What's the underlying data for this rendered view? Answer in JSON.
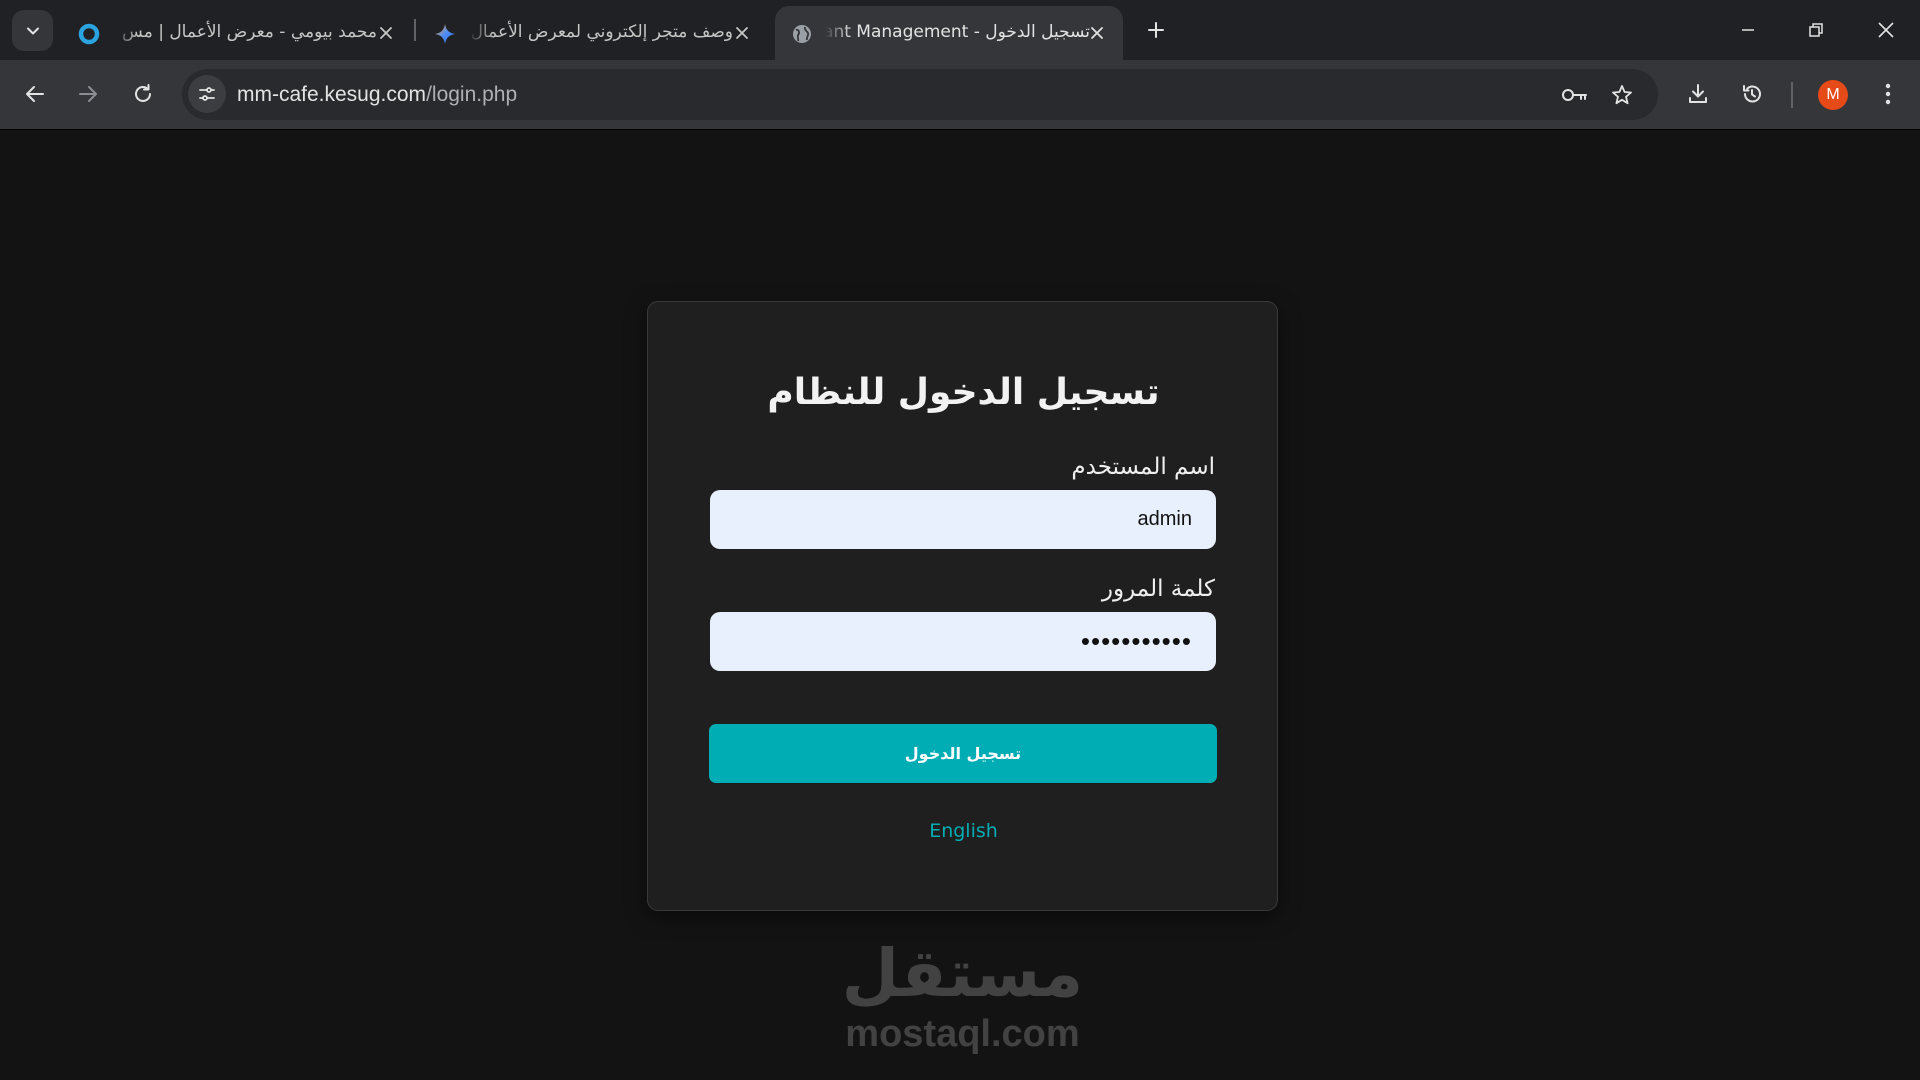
{
  "browser": {
    "tabs": [
      {
        "title": "محمد بيومي - معرض الأعمال | مس",
        "icon": "mostaql-ring-icon",
        "active": false
      },
      {
        "title": "وصف متجر إلكتروني لمعرض الأعمال",
        "icon": "gemini-sparkle-icon",
        "active": false
      },
      {
        "title": "تسجيل الدخول - Restaurant Management",
        "icon": "globe-icon",
        "active": true
      }
    ],
    "url_host": "mm-cafe.kesug.com",
    "url_path": "/login.php",
    "profile_initial": "M",
    "accent_color": "#e64a19"
  },
  "login": {
    "title": "تسجيل الدخول للنظام",
    "username_label": "اسم المستخدم",
    "username_value": "admin",
    "password_label": "كلمة المرور",
    "password_value": "•••••••••••",
    "submit_label": "تسجيل الدخول",
    "language_link": "English",
    "button_color": "#00adb5"
  },
  "watermark": {
    "arabic": "مستقل",
    "latin": "mostaql.com"
  }
}
